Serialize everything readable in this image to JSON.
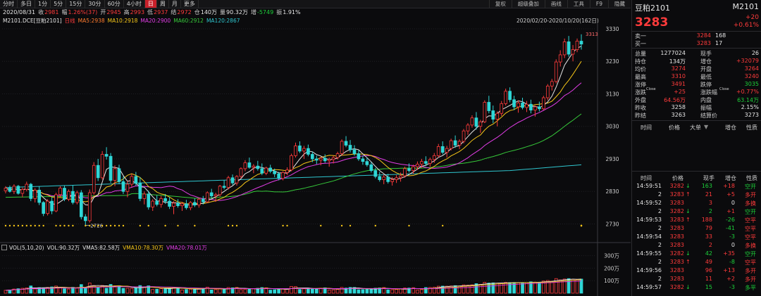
{
  "toolbar": {
    "periods": [
      "分时",
      "多日",
      "1分",
      "5分",
      "15分",
      "30分",
      "60分",
      "4小时",
      "日",
      "周",
      "月",
      "更多"
    ],
    "active_index": 8,
    "right_items": [
      "复权",
      "超级叠加",
      "画线",
      "工具",
      "F9",
      "隐藏"
    ]
  },
  "info": {
    "date": "2020/08/31",
    "close_label": "收",
    "close": "2981",
    "change_label": "幅",
    "change": "1.26%(37)",
    "open_label": "开",
    "open": "2945",
    "high_label": "高",
    "high": "2993",
    "low_label": "低",
    "low": "2937",
    "settle_label": "结",
    "settle": "2972",
    "oi_label": "仓",
    "oi": "140万",
    "vol_label": "量",
    "vol": "90.32万",
    "oi_chg_label": "增",
    "oi_chg": "-5749",
    "amp_label": "振",
    "amp": "1.91%"
  },
  "ma": {
    "symbol": "M2101.DCE",
    "name": "[豆粕2101]",
    "period": "日线",
    "ma5": "MA5:2938",
    "ma10": "MA10:2918",
    "ma20": "MA20:2900",
    "ma60": "MA60:2912",
    "ma120": "MA120:2867"
  },
  "range": "2020/02/20-2020/10/20(162日)",
  "price_axis": [
    "3330",
    "3230",
    "3130",
    "3030",
    "2930",
    "2830",
    "2730"
  ],
  "marks": {
    "high": "3313",
    "low": "2726"
  },
  "vol_info": {
    "title": "VOL(5,10,20)",
    "vol": "VOL:90.32万",
    "vma5": "VMA5:82.58万",
    "vma10": "VMA10:78.30万",
    "vma20": "VMA20:78.01万"
  },
  "vol_axis": [
    "300万",
    "200万",
    "100万"
  ],
  "colors": {
    "up": "#ff3b3b",
    "down": "#2fd6d6",
    "ma5": "#e6e6e6",
    "ma10": "#f5c518",
    "ma20": "#e23de6",
    "ma60": "#36c93a",
    "ma120": "#2fc6cf",
    "dot": "#f5c518"
  },
  "panel": {
    "title": "豆粕2101",
    "code": "M2101",
    "price": "3283",
    "change": "+20",
    "change_pct": "+0.61%",
    "ask_label": "卖一",
    "ask": "3284",
    "ask_vol": "168",
    "bid_label": "买一",
    "bid": "3283",
    "bid_vol": "17",
    "stats": [
      [
        "总量",
        "1277024",
        "现手",
        "26"
      ],
      [
        "持仓",
        "134万",
        "增仓",
        "+32079"
      ],
      [
        "均价",
        "3274",
        "开盘",
        "3264"
      ],
      [
        "最高",
        "3310",
        "最低",
        "3240"
      ],
      [
        "涨停",
        "3491",
        "跌停",
        "3035"
      ],
      [
        "涨跌",
        "+25",
        "涨跌幅",
        "+0.77%"
      ],
      [
        "外盘",
        "64.56万",
        "内盘",
        "63.14万"
      ],
      [
        "昨收",
        "3258",
        "振幅",
        "2.15%"
      ],
      [
        "昨结",
        "3263",
        "结算价",
        "3273"
      ]
    ],
    "close_tag": "Close",
    "table_header": [
      "时间",
      "价格",
      "大单",
      "增仓",
      "性质"
    ],
    "ticks_header": [
      "时间",
      "价格",
      "现手",
      "增仓",
      "性质"
    ],
    "ticks": [
      [
        "14:59:51",
        "3282",
        "↓",
        "163",
        "+18",
        "空开"
      ],
      [
        "2",
        "3283",
        "↑",
        "21",
        "+5",
        "多开"
      ],
      [
        "14:59:52",
        "3283",
        "",
        "3",
        "0",
        "多换"
      ],
      [
        "2",
        "3282",
        "↓",
        "2",
        "+1",
        "空开"
      ],
      [
        "14:59:53",
        "3283",
        "↑",
        "188",
        "-26",
        "空平"
      ],
      [
        "2",
        "3283",
        "",
        "79",
        "-41",
        "空平"
      ],
      [
        "14:59:54",
        "3283",
        "",
        "33",
        "-3",
        "空平"
      ],
      [
        "2",
        "3283",
        "",
        "2",
        "0",
        "多换"
      ],
      [
        "14:59:55",
        "3282",
        "↓",
        "42",
        "+35",
        "空开"
      ],
      [
        "2",
        "3283",
        "↑",
        "49",
        "-8",
        "空平"
      ],
      [
        "14:59:56",
        "3283",
        "",
        "96",
        "+13",
        "多开"
      ],
      [
        "2",
        "3283",
        "",
        "11",
        "+2",
        "多开"
      ],
      [
        "14:59:57",
        "3282",
        "↓",
        "15",
        "-3",
        "多平"
      ]
    ]
  },
  "chart_data": {
    "type": "candlestick",
    "range": "2020/02/20-2020/10/20",
    "ylim": [
      2690,
      3345
    ],
    "n": 162,
    "candles": [
      [
        2832,
        2846,
        2824,
        2840
      ],
      [
        2840,
        2848,
        2826,
        2830
      ],
      [
        2830,
        2852,
        2822,
        2846
      ],
      [
        2846,
        2850,
        2820,
        2824
      ],
      [
        2824,
        2842,
        2812,
        2836
      ],
      [
        2836,
        2860,
        2830,
        2852
      ],
      [
        2852,
        2856,
        2800,
        2808
      ],
      [
        2808,
        2840,
        2796,
        2834
      ],
      [
        2834,
        2846,
        2788,
        2796
      ],
      [
        2796,
        2800,
        2754,
        2762
      ],
      [
        2762,
        2806,
        2756,
        2800
      ],
      [
        2800,
        2812,
        2760,
        2770
      ],
      [
        2770,
        2826,
        2766,
        2820
      ],
      [
        2820,
        2846,
        2812,
        2840
      ],
      [
        2840,
        2848,
        2800,
        2806
      ],
      [
        2806,
        2836,
        2800,
        2830
      ],
      [
        2830,
        2848,
        2790,
        2796
      ],
      [
        2796,
        2832,
        2790,
        2826
      ],
      [
        2826,
        2834,
        2744,
        2752
      ],
      [
        2752,
        2760,
        2726,
        2740
      ],
      [
        2740,
        2836,
        2734,
        2826
      ],
      [
        2826,
        2920,
        2820,
        2910
      ],
      [
        2910,
        2930,
        2862,
        2872
      ],
      [
        2872,
        2954,
        2866,
        2944
      ],
      [
        2944,
        2966,
        2928,
        2938
      ],
      [
        2938,
        2948,
        2856,
        2864
      ],
      [
        2864,
        2910,
        2846,
        2900
      ],
      [
        2900,
        2912,
        2852,
        2860
      ],
      [
        2860,
        2876,
        2822,
        2830
      ],
      [
        2830,
        2862,
        2812,
        2852
      ],
      [
        2852,
        2884,
        2844,
        2876
      ],
      [
        2876,
        2890,
        2848,
        2856
      ],
      [
        2856,
        2874,
        2800,
        2808
      ],
      [
        2808,
        2830,
        2790,
        2822
      ],
      [
        2822,
        2832,
        2774,
        2782
      ],
      [
        2782,
        2806,
        2770,
        2800
      ],
      [
        2800,
        2818,
        2784,
        2790
      ],
      [
        2790,
        2816,
        2780,
        2808
      ],
      [
        2808,
        2822,
        2792,
        2800
      ],
      [
        2800,
        2812,
        2776,
        2784
      ],
      [
        2784,
        2800,
        2760,
        2794
      ],
      [
        2794,
        2806,
        2780,
        2786
      ],
      [
        2786,
        2798,
        2770,
        2792
      ],
      [
        2792,
        2804,
        2774,
        2780
      ],
      [
        2780,
        2800,
        2772,
        2796
      ],
      [
        2796,
        2808,
        2782,
        2788
      ],
      [
        2788,
        2810,
        2780,
        2806
      ],
      [
        2806,
        2816,
        2790,
        2798
      ],
      [
        2798,
        2830,
        2794,
        2826
      ],
      [
        2826,
        2838,
        2810,
        2816
      ],
      [
        2816,
        2826,
        2798,
        2820
      ],
      [
        2820,
        2850,
        2814,
        2846
      ],
      [
        2846,
        2864,
        2836,
        2842
      ],
      [
        2842,
        2878,
        2836,
        2872
      ],
      [
        2872,
        2882,
        2850,
        2856
      ],
      [
        2856,
        2880,
        2848,
        2876
      ],
      [
        2876,
        2904,
        2870,
        2900
      ],
      [
        2900,
        2926,
        2892,
        2918
      ],
      [
        2918,
        2934,
        2900,
        2904
      ],
      [
        2904,
        2914,
        2886,
        2908
      ],
      [
        2908,
        2924,
        2894,
        2900
      ],
      [
        2900,
        2916,
        2880,
        2886
      ],
      [
        2886,
        2906,
        2880,
        2902
      ],
      [
        2902,
        2912,
        2886,
        2892
      ],
      [
        2892,
        2900,
        2874,
        2884
      ],
      [
        2884,
        2890,
        2864,
        2870
      ],
      [
        2870,
        2892,
        2864,
        2888
      ],
      [
        2888,
        2904,
        2880,
        2896
      ],
      [
        2896,
        2946,
        2892,
        2940
      ],
      [
        2940,
        2980,
        2934,
        2970
      ],
      [
        2970,
        2984,
        2948,
        2954
      ],
      [
        2954,
        2970,
        2930,
        2962
      ],
      [
        2962,
        2974,
        2938,
        2944
      ],
      [
        2944,
        2952,
        2920,
        2930
      ],
      [
        2930,
        2940,
        2914,
        2926
      ],
      [
        2926,
        2936,
        2910,
        2932
      ],
      [
        2932,
        2944,
        2918,
        2924
      ],
      [
        2924,
        2934,
        2906,
        2928
      ],
      [
        2928,
        2940,
        2916,
        2934
      ],
      [
        2934,
        2952,
        2928,
        2946
      ],
      [
        2946,
        2990,
        2940,
        2984
      ],
      [
        2984,
        3000,
        2966,
        2972
      ],
      [
        2972,
        2988,
        2950,
        2958
      ],
      [
        2958,
        2972,
        2940,
        2946
      ],
      [
        2946,
        2956,
        2924,
        2930
      ],
      [
        2930,
        2940,
        2912,
        2922
      ],
      [
        2922,
        2934,
        2906,
        2912
      ],
      [
        2912,
        2920,
        2888,
        2894
      ],
      [
        2894,
        2902,
        2870,
        2876
      ],
      [
        2876,
        2890,
        2860,
        2866
      ],
      [
        2866,
        2882,
        2852,
        2874
      ],
      [
        2874,
        2884,
        2854,
        2860
      ],
      [
        2860,
        2874,
        2848,
        2866
      ],
      [
        2866,
        2880,
        2856,
        2872
      ],
      [
        2872,
        2888,
        2860,
        2878
      ],
      [
        2878,
        2906,
        2872,
        2900
      ],
      [
        2900,
        2916,
        2888,
        2894
      ],
      [
        2894,
        2912,
        2884,
        2906
      ],
      [
        2906,
        2922,
        2896,
        2914
      ],
      [
        2914,
        2930,
        2902,
        2922
      ],
      [
        2922,
        2938,
        2908,
        2916
      ],
      [
        2916,
        2934,
        2906,
        2928
      ],
      [
        2928,
        2948,
        2918,
        2940
      ],
      [
        2940,
        2976,
        2934,
        2968
      ],
      [
        2968,
        2984,
        2944,
        2950
      ],
      [
        2950,
        2970,
        2934,
        2962
      ],
      [
        2962,
        2992,
        2956,
        2986
      ],
      [
        2986,
        3002,
        2964,
        2972
      ],
      [
        2972,
        2990,
        2960,
        2984
      ],
      [
        2984,
        3022,
        2978,
        3016
      ],
      [
        3016,
        3040,
        3004,
        3034
      ],
      [
        3034,
        3064,
        3026,
        3056
      ],
      [
        3056,
        3074,
        3020,
        3030
      ],
      [
        3030,
        3050,
        3010,
        3044
      ],
      [
        3044,
        3110,
        3040,
        3104
      ],
      [
        3104,
        3124,
        3070,
        3078
      ],
      [
        3078,
        3094,
        3040,
        3052
      ],
      [
        3052,
        3076,
        3030,
        3070
      ],
      [
        3070,
        3108,
        3062,
        3100
      ],
      [
        3100,
        3146,
        3094,
        3138
      ],
      [
        3138,
        3150,
        3104,
        3112
      ],
      [
        3112,
        3124,
        3080,
        3090
      ],
      [
        3090,
        3110,
        3072,
        3102
      ],
      [
        3102,
        3118,
        3082,
        3088
      ],
      [
        3088,
        3108,
        3074,
        3098
      ],
      [
        3098,
        3112,
        3070,
        3080
      ],
      [
        3080,
        3094,
        3060,
        3090
      ],
      [
        3090,
        3106,
        3076,
        3084
      ],
      [
        3084,
        3124,
        3080,
        3118
      ],
      [
        3118,
        3160,
        3110,
        3154
      ],
      [
        3154,
        3176,
        3140,
        3168
      ],
      [
        3168,
        3236,
        3162,
        3228
      ],
      [
        3228,
        3264,
        3214,
        3250
      ],
      [
        3250,
        3300,
        3240,
        3290
      ],
      [
        3290,
        3308,
        3244,
        3252
      ],
      [
        3252,
        3280,
        3230,
        3266
      ],
      [
        3266,
        3300,
        3258,
        3292
      ],
      [
        3292,
        3313,
        3266,
        3283
      ]
    ]
  }
}
